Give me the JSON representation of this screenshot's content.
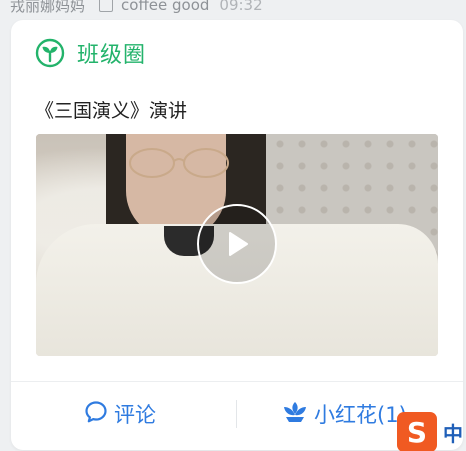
{
  "feed_header": {
    "author": "戎丽娜妈妈",
    "status": "coffee good",
    "time": "09:32"
  },
  "card": {
    "section_title": "班级圈",
    "section_icon": "sprout-icon",
    "post_text": "《三国演义》演讲",
    "video": {
      "play_icon": "play-icon"
    },
    "actions": {
      "comment_label": "评论",
      "comment_icon": "speech-bubble-icon",
      "flower_label": "小红花(1)",
      "flower_icon": "lotus-flower-icon"
    }
  },
  "colors": {
    "accent_green": "#23b36b",
    "action_blue": "#2f7be0",
    "ime_orange": "#f05a22"
  },
  "ime": {
    "logo_letter": "S",
    "mode_label": "中"
  }
}
